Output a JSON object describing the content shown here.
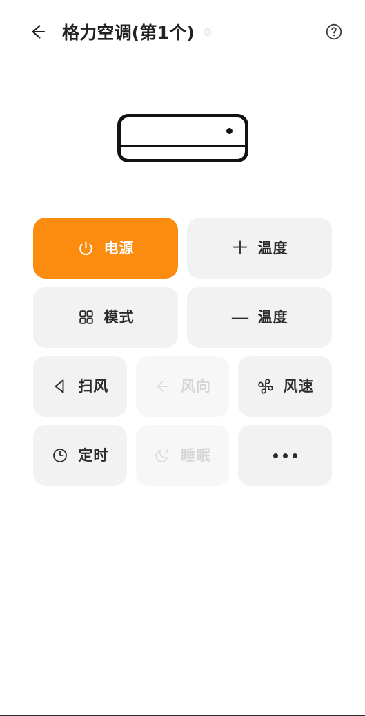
{
  "header": {
    "back_icon": "arrow-left-icon",
    "title": "格力空调(第1个)",
    "status_dot": "connection-status-dot",
    "help_icon": "help-circle-icon"
  },
  "device": {
    "illustration": "air-conditioner-illustration",
    "led": "device-led-indicator"
  },
  "controls": {
    "rows": [
      [
        {
          "label": "电源",
          "icon": "power-icon",
          "state": "active"
        },
        {
          "label": "温度",
          "icon": "plus-icon",
          "glyph": "＋",
          "state": "normal"
        }
      ],
      [
        {
          "label": "模式",
          "icon": "grid-mode-icon",
          "state": "normal"
        },
        {
          "label": "温度",
          "icon": "minus-icon",
          "glyph": "—",
          "state": "normal"
        }
      ],
      [
        {
          "label": "扫风",
          "icon": "swing-icon",
          "state": "normal"
        },
        {
          "label": "风向",
          "icon": "wind-direction-icon",
          "state": "disabled"
        },
        {
          "label": "风速",
          "icon": "fan-speed-icon",
          "state": "normal"
        }
      ],
      [
        {
          "label": "定时",
          "icon": "timer-clock-icon",
          "state": "normal"
        },
        {
          "label": "睡眠",
          "icon": "sleep-moon-icon",
          "state": "disabled"
        },
        {
          "label": "",
          "icon": "more-dots-icon",
          "state": "normal"
        }
      ]
    ]
  },
  "colors": {
    "accent": "#fc8c10",
    "button_bg": "#f2f2f2",
    "button_bg_disabled": "#f7f7f7",
    "text": "#2b2b2b",
    "text_disabled": "#d6d6d6",
    "background": "#ffffff"
  }
}
